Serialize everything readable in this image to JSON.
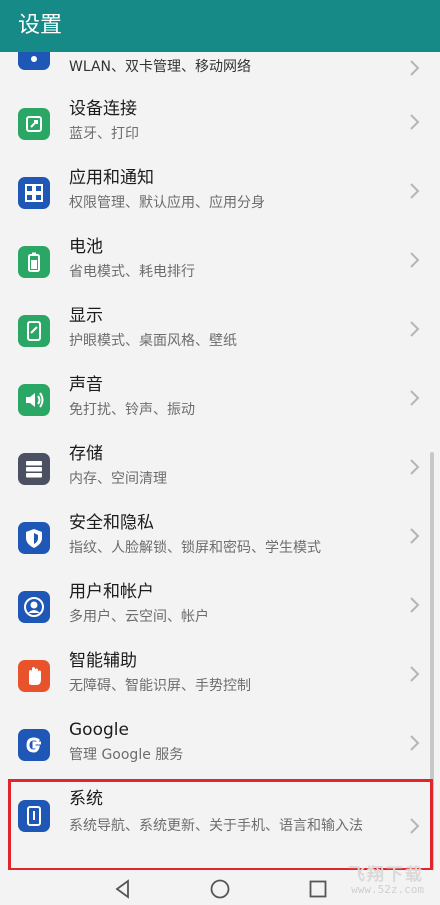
{
  "header": {
    "title": "设置"
  },
  "items": [
    {
      "title": "",
      "subtitle": "WLAN、双卡管理、移动网络",
      "icon": "wireless-network-icon",
      "color": "#1f57b6"
    },
    {
      "title": "设备连接",
      "subtitle": "蓝牙、打印",
      "icon": "device-connection-icon",
      "color": "#2aa764"
    },
    {
      "title": "应用和通知",
      "subtitle": "权限管理、默认应用、应用分身",
      "icon": "apps-grid-icon",
      "color": "#1f57b6"
    },
    {
      "title": "电池",
      "subtitle": "省电模式、耗电排行",
      "icon": "battery-icon",
      "color": "#2aa764"
    },
    {
      "title": "显示",
      "subtitle": "护眼模式、桌面风格、壁纸",
      "icon": "display-icon",
      "color": "#2aa764"
    },
    {
      "title": "声音",
      "subtitle": "免打扰、铃声、振动",
      "icon": "sound-icon",
      "color": "#2aa764"
    },
    {
      "title": "存储",
      "subtitle": "内存、空间清理",
      "icon": "storage-icon",
      "color": "#4b5161"
    },
    {
      "title": "安全和隐私",
      "subtitle": "指纹、人脸解锁、锁屏和密码、学生模式",
      "icon": "security-shield-icon",
      "color": "#1f57b6"
    },
    {
      "title": "用户和帐户",
      "subtitle": "多用户、云空间、帐户",
      "icon": "user-account-icon",
      "color": "#1f57b6"
    },
    {
      "title": "智能辅助",
      "subtitle": "无障碍、智能识屏、手势控制",
      "icon": "hand-gesture-icon",
      "color": "#e8532c"
    },
    {
      "title": "Google",
      "subtitle": "管理 Google 服务",
      "icon": "google-icon",
      "color": "#1f57b6"
    },
    {
      "title": "系统",
      "subtitle": "系统导航、系统更新、关于手机、语言和输入法",
      "icon": "system-phone-icon",
      "color": "#1f57b6"
    }
  ],
  "navbar": {
    "back": "back-icon",
    "home": "home-icon",
    "recents": "recents-icon"
  },
  "watermark": {
    "text": "飞翔下载",
    "url": "www.52z.com"
  }
}
